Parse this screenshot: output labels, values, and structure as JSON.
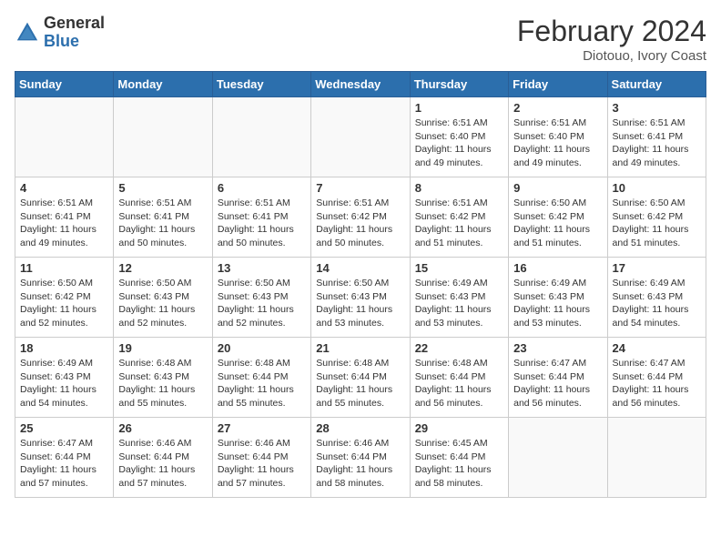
{
  "header": {
    "logo_line1": "General",
    "logo_line2": "Blue",
    "month_year": "February 2024",
    "location": "Diotouo, Ivory Coast"
  },
  "weekdays": [
    "Sunday",
    "Monday",
    "Tuesday",
    "Wednesday",
    "Thursday",
    "Friday",
    "Saturday"
  ],
  "weeks": [
    [
      {
        "day": "",
        "sunrise": "",
        "sunset": "",
        "daylight": ""
      },
      {
        "day": "",
        "sunrise": "",
        "sunset": "",
        "daylight": ""
      },
      {
        "day": "",
        "sunrise": "",
        "sunset": "",
        "daylight": ""
      },
      {
        "day": "",
        "sunrise": "",
        "sunset": "",
        "daylight": ""
      },
      {
        "day": "1",
        "sunrise": "Sunrise: 6:51 AM",
        "sunset": "Sunset: 6:40 PM",
        "daylight": "Daylight: 11 hours and 49 minutes."
      },
      {
        "day": "2",
        "sunrise": "Sunrise: 6:51 AM",
        "sunset": "Sunset: 6:40 PM",
        "daylight": "Daylight: 11 hours and 49 minutes."
      },
      {
        "day": "3",
        "sunrise": "Sunrise: 6:51 AM",
        "sunset": "Sunset: 6:41 PM",
        "daylight": "Daylight: 11 hours and 49 minutes."
      }
    ],
    [
      {
        "day": "4",
        "sunrise": "Sunrise: 6:51 AM",
        "sunset": "Sunset: 6:41 PM",
        "daylight": "Daylight: 11 hours and 49 minutes."
      },
      {
        "day": "5",
        "sunrise": "Sunrise: 6:51 AM",
        "sunset": "Sunset: 6:41 PM",
        "daylight": "Daylight: 11 hours and 50 minutes."
      },
      {
        "day": "6",
        "sunrise": "Sunrise: 6:51 AM",
        "sunset": "Sunset: 6:41 PM",
        "daylight": "Daylight: 11 hours and 50 minutes."
      },
      {
        "day": "7",
        "sunrise": "Sunrise: 6:51 AM",
        "sunset": "Sunset: 6:42 PM",
        "daylight": "Daylight: 11 hours and 50 minutes."
      },
      {
        "day": "8",
        "sunrise": "Sunrise: 6:51 AM",
        "sunset": "Sunset: 6:42 PM",
        "daylight": "Daylight: 11 hours and 51 minutes."
      },
      {
        "day": "9",
        "sunrise": "Sunrise: 6:50 AM",
        "sunset": "Sunset: 6:42 PM",
        "daylight": "Daylight: 11 hours and 51 minutes."
      },
      {
        "day": "10",
        "sunrise": "Sunrise: 6:50 AM",
        "sunset": "Sunset: 6:42 PM",
        "daylight": "Daylight: 11 hours and 51 minutes."
      }
    ],
    [
      {
        "day": "11",
        "sunrise": "Sunrise: 6:50 AM",
        "sunset": "Sunset: 6:42 PM",
        "daylight": "Daylight: 11 hours and 52 minutes."
      },
      {
        "day": "12",
        "sunrise": "Sunrise: 6:50 AM",
        "sunset": "Sunset: 6:43 PM",
        "daylight": "Daylight: 11 hours and 52 minutes."
      },
      {
        "day": "13",
        "sunrise": "Sunrise: 6:50 AM",
        "sunset": "Sunset: 6:43 PM",
        "daylight": "Daylight: 11 hours and 52 minutes."
      },
      {
        "day": "14",
        "sunrise": "Sunrise: 6:50 AM",
        "sunset": "Sunset: 6:43 PM",
        "daylight": "Daylight: 11 hours and 53 minutes."
      },
      {
        "day": "15",
        "sunrise": "Sunrise: 6:49 AM",
        "sunset": "Sunset: 6:43 PM",
        "daylight": "Daylight: 11 hours and 53 minutes."
      },
      {
        "day": "16",
        "sunrise": "Sunrise: 6:49 AM",
        "sunset": "Sunset: 6:43 PM",
        "daylight": "Daylight: 11 hours and 53 minutes."
      },
      {
        "day": "17",
        "sunrise": "Sunrise: 6:49 AM",
        "sunset": "Sunset: 6:43 PM",
        "daylight": "Daylight: 11 hours and 54 minutes."
      }
    ],
    [
      {
        "day": "18",
        "sunrise": "Sunrise: 6:49 AM",
        "sunset": "Sunset: 6:43 PM",
        "daylight": "Daylight: 11 hours and 54 minutes."
      },
      {
        "day": "19",
        "sunrise": "Sunrise: 6:48 AM",
        "sunset": "Sunset: 6:43 PM",
        "daylight": "Daylight: 11 hours and 55 minutes."
      },
      {
        "day": "20",
        "sunrise": "Sunrise: 6:48 AM",
        "sunset": "Sunset: 6:44 PM",
        "daylight": "Daylight: 11 hours and 55 minutes."
      },
      {
        "day": "21",
        "sunrise": "Sunrise: 6:48 AM",
        "sunset": "Sunset: 6:44 PM",
        "daylight": "Daylight: 11 hours and 55 minutes."
      },
      {
        "day": "22",
        "sunrise": "Sunrise: 6:48 AM",
        "sunset": "Sunset: 6:44 PM",
        "daylight": "Daylight: 11 hours and 56 minutes."
      },
      {
        "day": "23",
        "sunrise": "Sunrise: 6:47 AM",
        "sunset": "Sunset: 6:44 PM",
        "daylight": "Daylight: 11 hours and 56 minutes."
      },
      {
        "day": "24",
        "sunrise": "Sunrise: 6:47 AM",
        "sunset": "Sunset: 6:44 PM",
        "daylight": "Daylight: 11 hours and 56 minutes."
      }
    ],
    [
      {
        "day": "25",
        "sunrise": "Sunrise: 6:47 AM",
        "sunset": "Sunset: 6:44 PM",
        "daylight": "Daylight: 11 hours and 57 minutes."
      },
      {
        "day": "26",
        "sunrise": "Sunrise: 6:46 AM",
        "sunset": "Sunset: 6:44 PM",
        "daylight": "Daylight: 11 hours and 57 minutes."
      },
      {
        "day": "27",
        "sunrise": "Sunrise: 6:46 AM",
        "sunset": "Sunset: 6:44 PM",
        "daylight": "Daylight: 11 hours and 57 minutes."
      },
      {
        "day": "28",
        "sunrise": "Sunrise: 6:46 AM",
        "sunset": "Sunset: 6:44 PM",
        "daylight": "Daylight: 11 hours and 58 minutes."
      },
      {
        "day": "29",
        "sunrise": "Sunrise: 6:45 AM",
        "sunset": "Sunset: 6:44 PM",
        "daylight": "Daylight: 11 hours and 58 minutes."
      },
      {
        "day": "",
        "sunrise": "",
        "sunset": "",
        "daylight": ""
      },
      {
        "day": "",
        "sunrise": "",
        "sunset": "",
        "daylight": ""
      }
    ]
  ]
}
